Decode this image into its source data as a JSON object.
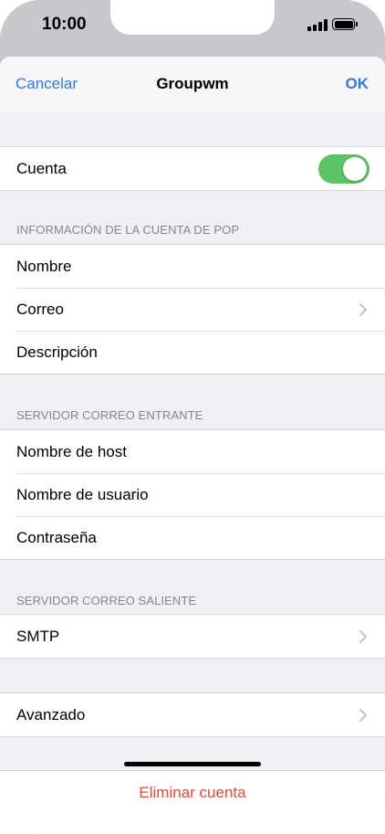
{
  "status_bar": {
    "time": "10:00"
  },
  "nav": {
    "cancel_label": "Cancelar",
    "title": "Groupwm",
    "ok_label": "OK"
  },
  "account": {
    "label": "Cuenta",
    "enabled": true
  },
  "pop_section": {
    "header": "INFORMACIÓN DE LA CUENTA DE POP",
    "items": [
      {
        "label": "Nombre"
      },
      {
        "label": "Correo"
      },
      {
        "label": "Descripción"
      }
    ]
  },
  "incoming_section": {
    "header": "SERVIDOR CORREO ENTRANTE",
    "items": [
      {
        "label": "Nombre de host"
      },
      {
        "label": "Nombre de usuario"
      },
      {
        "label": "Contraseña"
      }
    ]
  },
  "outgoing_section": {
    "header": "SERVIDOR CORREO SALIENTE",
    "items": [
      {
        "label": "SMTP"
      }
    ]
  },
  "advanced": {
    "label": "Avanzado"
  },
  "delete": {
    "label": "Eliminar cuenta"
  },
  "colors": {
    "accent": "#2f7be0",
    "toggle_on": "#5bc467",
    "destructive": "#e0483d",
    "grouped_background": "#efeff4"
  },
  "icons": {
    "chevron": "chevron-right-icon",
    "signal": "cellular-signal-icon",
    "battery": "battery-icon"
  }
}
